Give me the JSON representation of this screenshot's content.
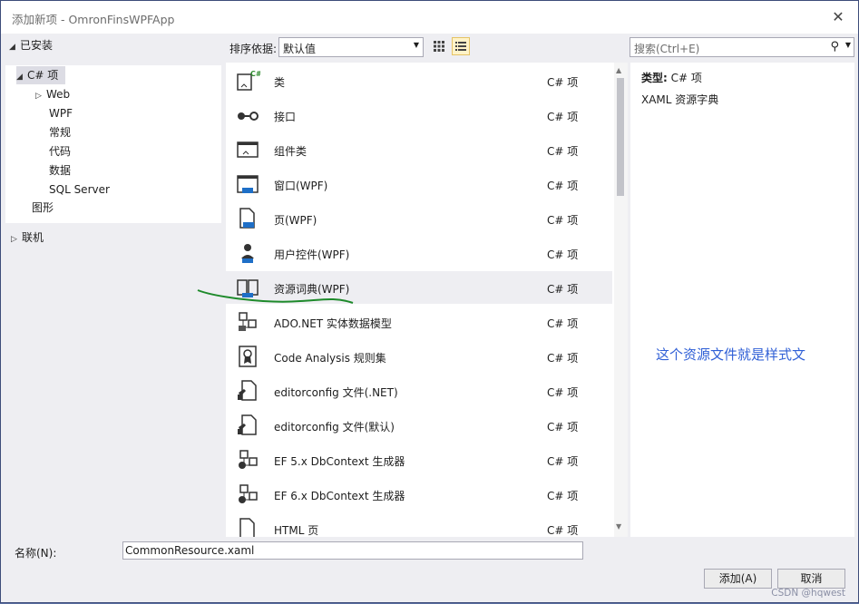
{
  "window": {
    "title": "添加新项 - OmronFinsWPFApp",
    "close": "✕"
  },
  "tree": {
    "installed": "已安装",
    "csharp": "C# 项",
    "web": "Web",
    "wpf": "WPF",
    "general": "常规",
    "code": "代码",
    "data": "数据",
    "sqlserver": "SQL Server",
    "graphics": "图形",
    "online": "联机"
  },
  "toolbar": {
    "sort_label": "排序依据:",
    "sort_value": "默认值",
    "search_placeholder": "搜索(Ctrl+E)"
  },
  "items": [
    {
      "name": "类",
      "lang": "C# 项",
      "icon": "class-icon"
    },
    {
      "name": "接口",
      "lang": "C# 项",
      "icon": "interface-icon"
    },
    {
      "name": "组件类",
      "lang": "C# 项",
      "icon": "component-class-icon"
    },
    {
      "name": "窗口(WPF)",
      "lang": "C# 项",
      "icon": "window-icon"
    },
    {
      "name": "页(WPF)",
      "lang": "C# 项",
      "icon": "page-icon"
    },
    {
      "name": "用户控件(WPF)",
      "lang": "C# 项",
      "icon": "user-control-icon"
    },
    {
      "name": "资源词典(WPF)",
      "lang": "C# 项",
      "icon": "resource-dictionary-icon"
    },
    {
      "name": "ADO.NET 实体数据模型",
      "lang": "C# 项",
      "icon": "entity-model-icon"
    },
    {
      "name": "Code Analysis 规则集",
      "lang": "C# 项",
      "icon": "ruleset-icon"
    },
    {
      "name": "editorconfig 文件(.NET)",
      "lang": "C# 项",
      "icon": "editorconfig-icon"
    },
    {
      "name": "editorconfig 文件(默认)",
      "lang": "C# 项",
      "icon": "editorconfig-icon"
    },
    {
      "name": "EF 5.x DbContext 生成器",
      "lang": "C# 项",
      "icon": "ef-generator-icon"
    },
    {
      "name": "EF 6.x DbContext 生成器",
      "lang": "C# 项",
      "icon": "ef-generator-icon"
    },
    {
      "name": "HTML 页",
      "lang": "C# 项",
      "icon": "html-page-icon"
    }
  ],
  "info": {
    "type_label": "类型:",
    "type_value": "C# 项",
    "description": "XAML 资源字典",
    "annotation": "这个资源文件就是样式文"
  },
  "bottom": {
    "name_label": "名称(N):",
    "name_value": "CommonResource.xaml",
    "add_button": "添加(A)",
    "cancel_button": "取消",
    "watermark": "CSDN @hqwest"
  }
}
